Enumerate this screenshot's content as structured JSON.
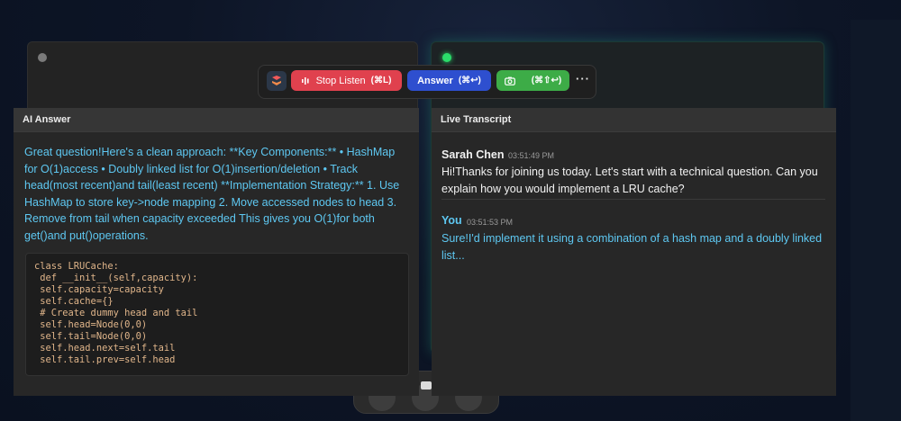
{
  "toolbar": {
    "stop_label": "Stop Listen",
    "stop_shortcut": "(⌘L)",
    "answer_label": "Answer",
    "answer_shortcut": "(⌘↩)",
    "screenshot_shortcut": "(⌘⇧↩)",
    "more": "···"
  },
  "ai_panel": {
    "title": "AI Answer",
    "answer": "Great question!Here's a clean approach: **Key Components:** • HashMap for O(1)access • Doubly linked list for O(1)insertion/deletion • Track head(most recent)and tail(least recent) **Implementation Strategy:** 1. Use HashMap to store key->node mapping 2. Move accessed nodes to head 3. Remove from tail when capacity exceeded This gives you O(1)for both get()and put()operations.",
    "code": [
      "class LRUCache:",
      " def __init__(self,capacity):",
      " self.capacity=capacity",
      " self.cache={}",
      " # Create dummy head and tail",
      " self.head=Node(0,0)",
      " self.tail=Node(0,0)",
      " self.head.next=self.tail",
      " self.tail.prev=self.head"
    ]
  },
  "transcript_panel": {
    "title": "Live Transcript",
    "messages": [
      {
        "speaker": "Sarah Chen",
        "time": "03:51:49 PM",
        "text": "Hi!Thanks for joining us today. Let's start with a technical question. Can you explain how you would implement a LRU cache?"
      },
      {
        "speaker": "You",
        "time": "03:51:53 PM",
        "text": "Sure!I'd implement it using a combination of a hash map and a doubly linked list..."
      }
    ]
  },
  "colors": {
    "stop": "#e0414e",
    "answer": "#2e4fcf",
    "screenshot": "#3dac47",
    "accent_text": "#5ec8f2",
    "live_indicator": "#2bdc6a"
  },
  "icons": {
    "app": "app-logo-icon",
    "stop": "audio-wave-icon",
    "screenshot": "camera-icon",
    "more": "more-icon"
  }
}
